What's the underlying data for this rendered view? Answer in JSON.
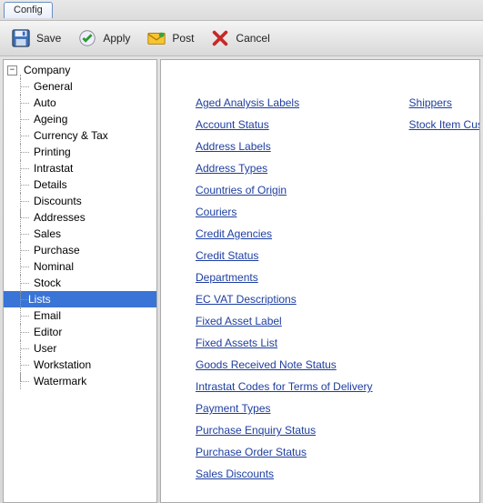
{
  "tab": {
    "label": "Config"
  },
  "toolbar": {
    "save": "Save",
    "apply": "Apply",
    "post": "Post",
    "cancel": "Cancel"
  },
  "tree": {
    "root": "Company",
    "company_children": [
      "General",
      "Auto",
      "Ageing",
      "Currency & Tax",
      "Printing",
      "Intrastat",
      "Details",
      "Discounts",
      "Addresses"
    ],
    "siblings": [
      "Sales",
      "Purchase",
      "Nominal",
      "Stock",
      "Lists",
      "Email",
      "Editor",
      "User",
      "Workstation",
      "Watermark"
    ],
    "selected": "Lists"
  },
  "links_left": [
    "Aged Analysis Labels",
    "Account Status",
    "Address Labels",
    "Address Types",
    "Countries of Origin",
    "Couriers",
    "Credit Agencies",
    "Credit Status",
    "Departments",
    "EC VAT Descriptions",
    "Fixed Asset Label",
    "Fixed Assets List",
    "Goods Received Note Status",
    "Intrastat Codes for Terms of Delivery",
    "Payment Types",
    "Purchase Enquiry Status",
    "Purchase Order Status",
    "Sales Discounts"
  ],
  "links_right": [
    "Shippers",
    "Stock Item Custom Parameter Labels"
  ]
}
